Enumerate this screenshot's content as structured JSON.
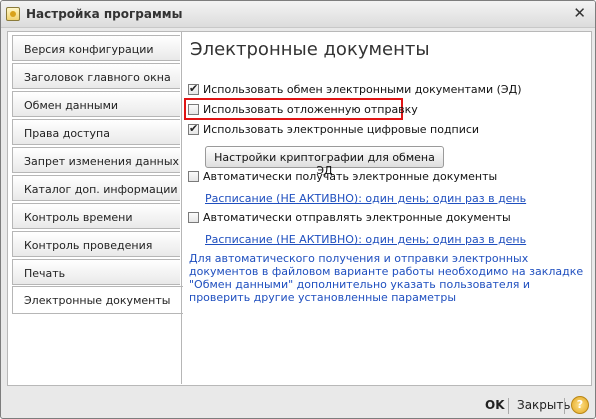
{
  "window": {
    "title": "Настройка программы"
  },
  "tabs": [
    {
      "label": "Версия конфигурации"
    },
    {
      "label": "Заголовок главного окна"
    },
    {
      "label": "Обмен данными"
    },
    {
      "label": "Права доступа"
    },
    {
      "label": "Запрет изменения данных"
    },
    {
      "label": "Каталог доп. информации"
    },
    {
      "label": "Контроль времени"
    },
    {
      "label": "Контроль проведения"
    },
    {
      "label": "Печать"
    },
    {
      "label": "Электронные документы",
      "active": true
    }
  ],
  "content": {
    "heading": "Электронные документы",
    "options": [
      {
        "label": "Использовать обмен электронными документами (ЭД)",
        "checked": true
      },
      {
        "label": "Использовать отложенную отправку",
        "checked": false
      },
      {
        "label": "Использовать электронные цифровые подписи",
        "checked": true
      },
      {
        "label": "Автоматически получать электронные документы",
        "checked": false
      },
      {
        "label": "Автоматически отправлять электронные документы",
        "checked": false
      }
    ],
    "crypto_button": "Настройки криптографии для обмена ЭД",
    "schedule_receive": "Расписание (НЕ АКТИВНО): один день; один раз в день",
    "schedule_send": "Расписание (НЕ АКТИВНО): один день; один раз в день",
    "info_text": "Для автоматического получения и отправки электронных документов в файловом варианте работы необходимо на закладке \"Обмен данными\" дополнительно указать пользователя и проверить другие установленные параметры"
  },
  "footer": {
    "ok": "OK",
    "close": "Закрыть",
    "help": "?"
  },
  "colors": {
    "highlight": "#e01515",
    "link": "#1f4fbf"
  }
}
